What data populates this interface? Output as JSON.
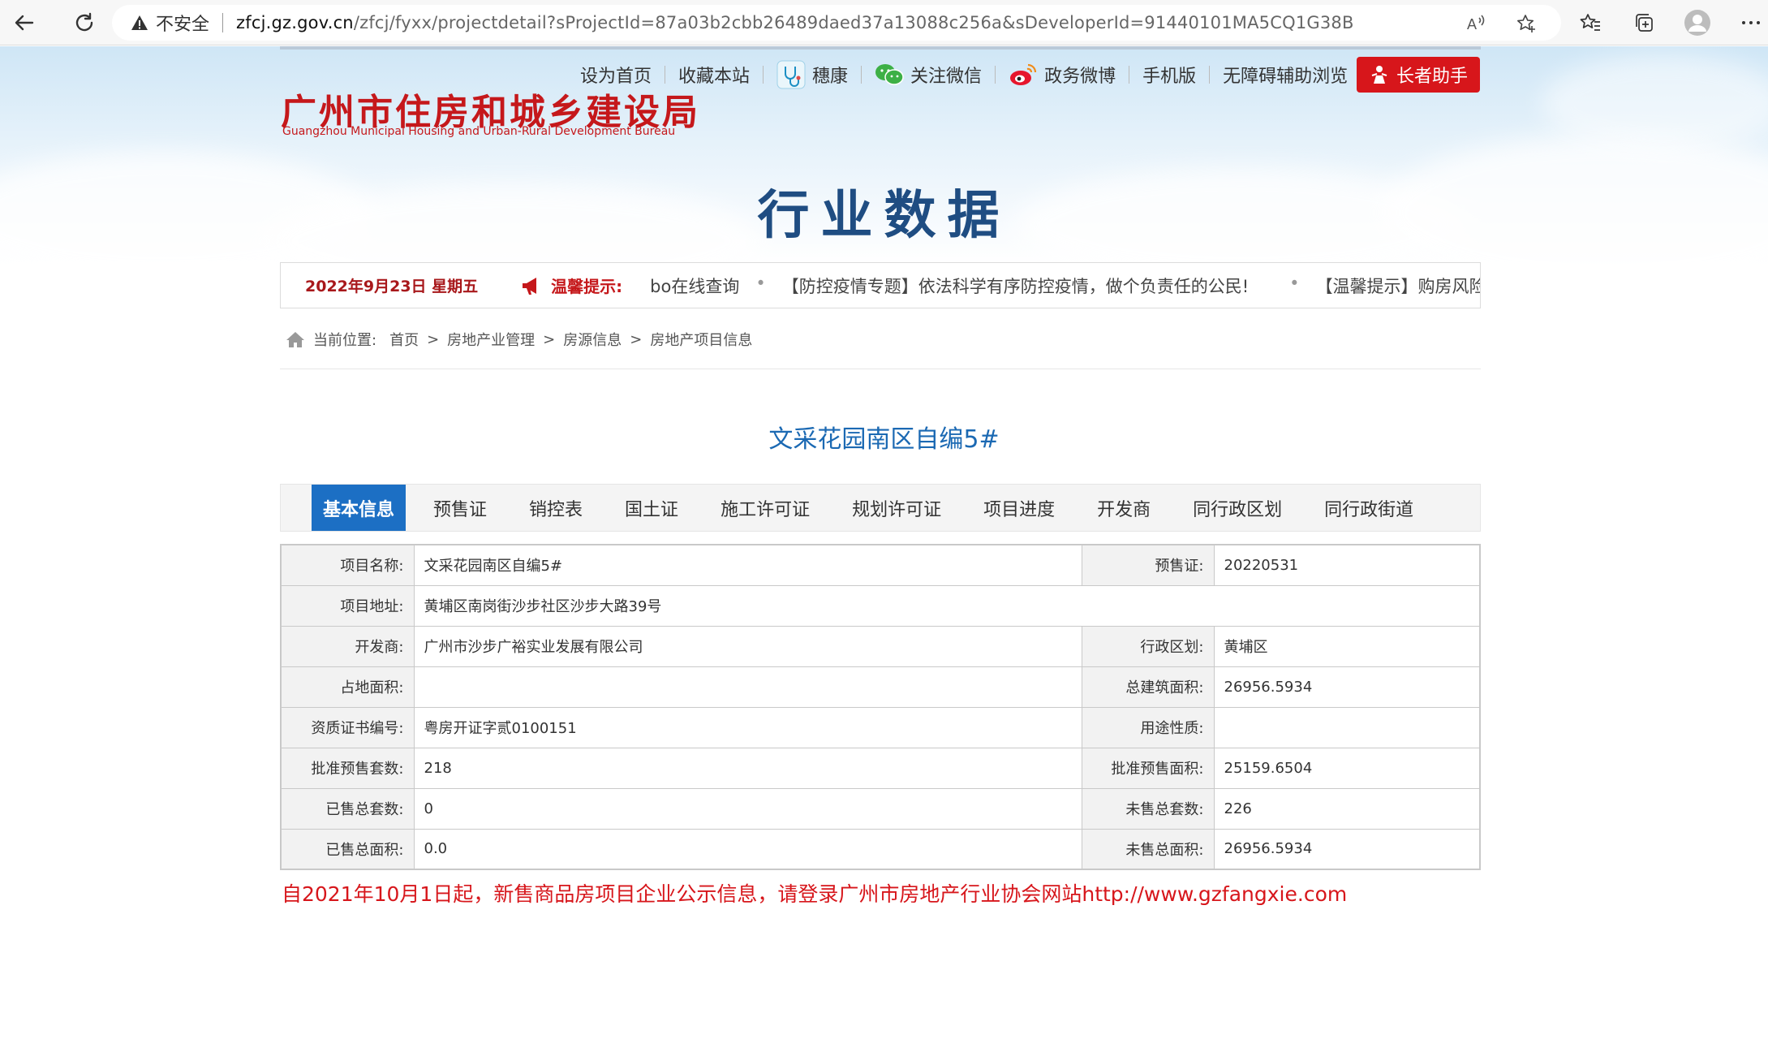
{
  "browser": {
    "security_label": "不安全",
    "url_host": "zfcj.gz.gov.cn",
    "url_rest": "/zfcj/fyxx/projectdetail?sProjectId=87a03b2cbb26489daed37a13088c256a&sDeveloperId=91440101MA5CQ1G38B"
  },
  "header": {
    "logo_cn": "广州市住房和城乡建设局",
    "logo_en": "Guangzhou Municipal Housing and Urban-Rural Development Bureau",
    "links": {
      "home": "设为首页",
      "favorite": "收藏本站",
      "suikang": "穗康",
      "wechat": "关注微信",
      "weibo": "政务微博",
      "mobile": "手机版",
      "accessible": "无障碍辅助浏览"
    },
    "elder_button": "长者助手",
    "section_title": "行业数据"
  },
  "notice": {
    "date": "2022年9月23日 星期五",
    "label": "温馨提示:",
    "items": [
      "bo在线查询",
      "【防控疫情专题】依法科学有序防控疫情，做个负责任的公民!",
      "【温馨提示】购房风险"
    ]
  },
  "breadcrumb": {
    "prefix": "当前位置:",
    "items": [
      "首页",
      "房地产业管理",
      "房源信息",
      "房地产项目信息"
    ],
    "separator": ">"
  },
  "project_title": "文采花园南区自编5#",
  "tabs": [
    "基本信息",
    "预售证",
    "销控表",
    "国土证",
    "施工许可证",
    "规划许可证",
    "项目进度",
    "开发商",
    "同行政区划",
    "同行政街道"
  ],
  "info": {
    "project_name_label": "项目名称:",
    "project_name": "文采花园南区自编5#",
    "presale_cert_label": "预售证:",
    "presale_cert": "20220531",
    "address_label": "项目地址:",
    "address": "黄埔区南岗街沙步社区沙步大路39号",
    "developer_label": "开发商:",
    "developer": "广州市沙步广裕实业发展有限公司",
    "district_label": "行政区划:",
    "district": "黄埔区",
    "land_area_label": "占地面积:",
    "land_area": "",
    "total_building_area_label": "总建筑面积:",
    "total_building_area": "26956.5934",
    "qual_cert_label": "资质证书编号:",
    "qual_cert": "粤房开证字贰0100151",
    "usage_label": "用途性质:",
    "usage": "",
    "approved_units_label": "批准预售套数:",
    "approved_units": "218",
    "approved_area_label": "批准预售面积:",
    "approved_area": "25159.6504",
    "sold_units_label": "已售总套数:",
    "sold_units": "0",
    "unsold_units_label": "未售总套数:",
    "unsold_units": "226",
    "sold_area_label": "已售总面积:",
    "sold_area": "0.0",
    "unsold_area_label": "未售总面积:",
    "unsold_area": "26956.5934"
  },
  "footer_note": "自2021年10月1日起，新售商品房项目企业公示信息，请登录广州市房地产行业协会网站http://www.gzfangxie.com"
}
